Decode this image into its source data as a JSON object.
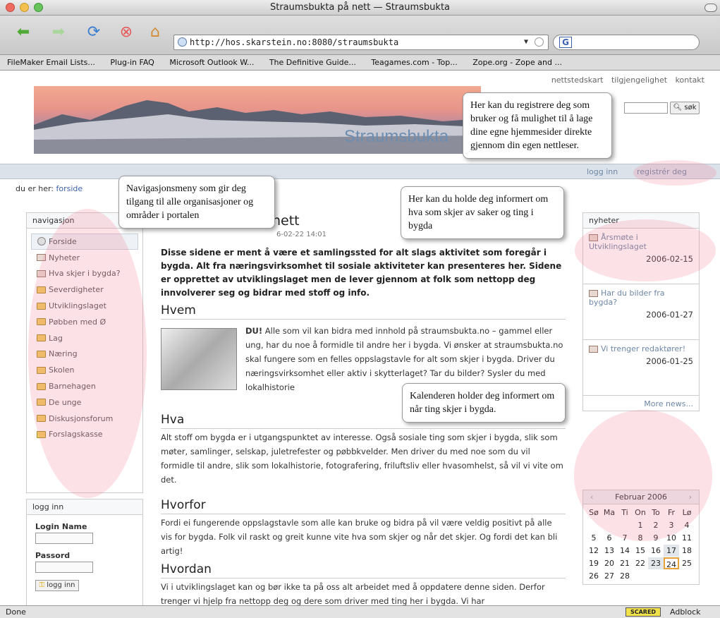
{
  "window": {
    "title": "Straumsbukta på nett — Straumsbukta"
  },
  "toolbar": {
    "url": "http://hos.skarstein.no:8080/straumsbukta",
    "search_prefix": "G"
  },
  "bookmarks": [
    "FileMaker Email Lists...",
    "Plug-in FAQ",
    "Microsoft Outlook W...",
    "The Definitive Guide...",
    "Teagames.com - Top...",
    "Zope.org - Zope and ..."
  ],
  "site": {
    "top_links": [
      "nettstedskart",
      "tilgjengelighet",
      "kontakt"
    ],
    "banner_text": "Straumsbukta",
    "search_button": "søk",
    "login_link": "logg inn",
    "register_link": "registrér deg",
    "breadcrumb_label": "du er her:",
    "breadcrumb_link": "forside"
  },
  "nav": {
    "title": "navigasjon",
    "items": [
      {
        "label": "Forside",
        "icon": "home-circle-icon"
      },
      {
        "label": "Nyheter",
        "icon": "document-icon"
      },
      {
        "label": "Hva skjer i bygda?",
        "icon": "document-icon"
      },
      {
        "label": "Severdigheter",
        "icon": "folder-icon"
      },
      {
        "label": "Utviklingslaget",
        "icon": "folder-icon"
      },
      {
        "label": "Pøbben med Ø",
        "icon": "folder-icon"
      },
      {
        "label": "Lag",
        "icon": "folder-icon"
      },
      {
        "label": "Næring",
        "icon": "folder-icon"
      },
      {
        "label": "Skolen",
        "icon": "folder-icon"
      },
      {
        "label": "Barnehagen",
        "icon": "folder-icon"
      },
      {
        "label": "De unge",
        "icon": "folder-icon"
      },
      {
        "label": "Diskusjonsforum",
        "icon": "folder-icon"
      },
      {
        "label": "Forslagskasse",
        "icon": "folder-icon"
      }
    ]
  },
  "login": {
    "title": "logg inn",
    "name_label": "Login Name",
    "password_label": "Passord",
    "button": "logg inn"
  },
  "article": {
    "title": "nett",
    "date": "6-02-22 14:01",
    "lead": "Disse sidene er ment å være et samlingssted for alt slags aktivitet som foregår i bygda. Alt fra næringsvirksomhet til sosiale aktiviteter kan presenteres her. Sidene er opprettet av utviklingslaget men de lever gjennom at folk som nettopp deg innvolverer seg og bidrar med stoff og info.",
    "sections": [
      {
        "heading": "Hvem",
        "bold_start": "DU!",
        "text": " Alle som vil kan bidra med innhold på straumsbukta.no – gammel eller ung, har du noe å formidle til andre her i bygda. Vi ønsker at straumsbukta.no skal fungere som en felles oppslagstavle for alt som skjer i bygda. Driver du næringsvirksomhet eller aktiv i skytterlaget? Tar du bilder? Sysler du med lokalhistorie"
      },
      {
        "heading": "Hva",
        "text": "Alt stoff om bygda er i utgangspunktet av interesse. Også sosiale ting som skjer i bygda, slik som møter, samlinger, selskap, juletrefester og pøbbkvelder. Men driver du med noe som du vil formidle til andre, slik som lokalhistorie, fotografering, friluftsliv eller hvasomhelst, så vil vi vite om det."
      },
      {
        "heading": "Hvorfor",
        "text": "Fordi ei fungerende oppslagstavle som alle kan bruke og bidra på vil være veldig positivt på alle vis for bygda. Folk vil raskt og greit kunne vite hva som skjer og når det skjer. Og fordi det kan bli artig!"
      },
      {
        "heading": "Hvordan",
        "text": "Vi i utviklingslaget kan og bør ikke ta på oss alt arbeidet med å oppdatere denne siden. Derfor trenger vi hjelp fra nettopp deg og dere som driver med ting her i bygda. Vi har"
      }
    ]
  },
  "news": {
    "title": "nyheter",
    "items": [
      {
        "title": "Årsmøte i Utviklingslaget",
        "date": "2006-02-15"
      },
      {
        "title": "Har du bilder fra bygda?",
        "date": "2006-01-27"
      },
      {
        "title": "Vi trenger redaktører!",
        "date": "2006-01-25"
      }
    ],
    "more": "More news..."
  },
  "calendar": {
    "month": "Februar 2006",
    "weekdays": [
      "Sø",
      "Ma",
      "Ti",
      "On",
      "To",
      "Fr",
      "Lø"
    ],
    "cells": [
      "",
      "",
      "",
      "1",
      "2",
      "3",
      "4",
      "5",
      "6",
      "7",
      "8",
      "9",
      "10",
      "11",
      "12",
      "13",
      "14",
      "15",
      "16",
      "17",
      "18",
      "19",
      "20",
      "21",
      "22",
      "23",
      "24",
      "25",
      "26",
      "27",
      "28"
    ]
  },
  "annotations": [
    "Her kan du registrere deg som bruker og få mulighet til å lage dine egne hjemmesider direkte gjennom din egen nettleser.",
    "Navigasjonsmeny som gir deg tilgang til alle organisasjoner og områder i portalen",
    "Her kan du holde deg informert om hva som skjer av saker og ting i bygda",
    "Kalenderen holder deg informert om når ting skjer i bygda."
  ],
  "status": {
    "left": "Done",
    "scared": "SCARED",
    "adblock": "Adblock"
  }
}
